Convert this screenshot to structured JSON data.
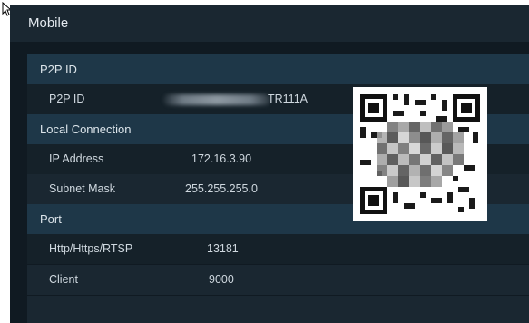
{
  "window": {
    "title": "Mobile"
  },
  "sections": {
    "p2p": {
      "label": "P2P ID"
    },
    "local": {
      "label": "Local Connection"
    },
    "port": {
      "label": "Port"
    }
  },
  "p2p": {
    "key": "P2P ID",
    "value_suffix": "TR111A"
  },
  "local": {
    "ip_key": "IP Address",
    "ip_value": "172.16.3.90",
    "mask_key": "Subnet Mask",
    "mask_value": "255.255.255.0"
  },
  "port": {
    "http_key": "Http/Https/RTSP",
    "http_value": "13181",
    "client_key": "Client",
    "client_value": "9000"
  },
  "qr": {
    "icon": "qr-code-icon"
  },
  "cursor": {
    "icon": "mouse-pointer-icon"
  }
}
